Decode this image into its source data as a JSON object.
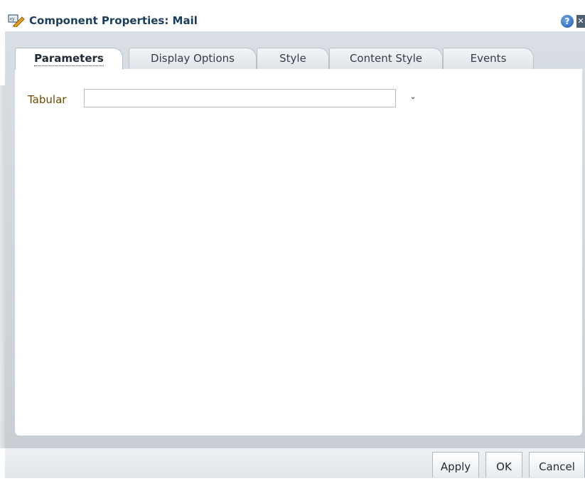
{
  "dialog": {
    "title": "Component Properties: Mail",
    "title_icon": "pencil-edit-icon",
    "help_icon": "help-icon",
    "help_glyph": "?",
    "close_icon": "close-icon",
    "close_glyph": "✕"
  },
  "tabs": [
    {
      "label": "Parameters",
      "active": true
    },
    {
      "label": "Display Options",
      "active": false
    },
    {
      "label": "Style",
      "active": false
    },
    {
      "label": "Content Style",
      "active": false
    },
    {
      "label": "Events",
      "active": false
    }
  ],
  "form": {
    "tabular_label": "Tabular",
    "tabular_value": "",
    "dropdown_icon": "chevron-down-icon",
    "dropdown_glyph": "⌄"
  },
  "buttons": {
    "apply": "Apply",
    "ok": "OK",
    "cancel": "Cancel"
  },
  "colors": {
    "title_text": "#1c3d5c",
    "label_text": "#6b4a00",
    "frame_bg": "#d2d9df"
  }
}
